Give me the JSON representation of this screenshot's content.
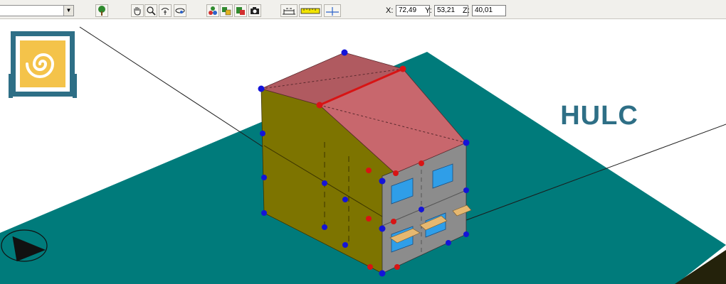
{
  "toolbar": {
    "combo_value": "",
    "combo_arrow_icon": "chevron-down-icon",
    "buttons": [
      {
        "name": "tree-button",
        "icon": "tree-icon"
      },
      {
        "name": "pan-hand-button",
        "icon": "hand-icon"
      },
      {
        "name": "zoom-button",
        "icon": "magnifier-icon"
      },
      {
        "name": "rotate-view-button",
        "icon": "rotate-icon"
      },
      {
        "name": "orbit-view-button",
        "icon": "orbit-icon"
      },
      {
        "name": "shapes-button",
        "icon": "shapes-icon"
      },
      {
        "name": "layers-button",
        "icon": "layers-icon"
      },
      {
        "name": "render-button",
        "icon": "render-icon"
      },
      {
        "name": "camera-button",
        "icon": "camera-icon"
      },
      {
        "name": "measure-tool-button",
        "icon": "measure-icon"
      },
      {
        "name": "ruler-button",
        "icon": "ruler-icon"
      },
      {
        "name": "axis-cursor-button",
        "icon": "crosshair-icon"
      }
    ],
    "coords": {
      "x_label": "X:",
      "x_value": "72,49",
      "y_label": "Y:",
      "y_value": "53,21",
      "z_label": "Z:",
      "z_value": "40,01"
    }
  },
  "logo": {
    "text": "HULC",
    "colors": {
      "frame": "#2e6f86",
      "tile": "#f4c34a",
      "spiral": "#ffffff"
    }
  },
  "scene": {
    "colors": {
      "ground": "#007b7b",
      "roof": "#c8676d",
      "side_wall": "#7d7400",
      "front_wall": "#8c8c8c",
      "window": "#2f9ee8",
      "shade": "#e6b870",
      "vertex_blue": "#1414d8",
      "vertex_red": "#d81414"
    }
  }
}
